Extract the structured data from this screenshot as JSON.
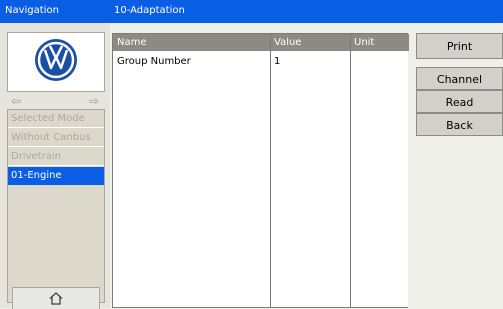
{
  "titlebar": {
    "nav_title": "Navigation",
    "page_title": "10-Adaptation"
  },
  "logo": {
    "icon": "vw-logo-icon"
  },
  "nav": {
    "back_icon": "arrow-left-icon",
    "forward_icon": "arrow-right-icon",
    "items": [
      {
        "label": "Selected Mode",
        "active": false
      },
      {
        "label": "Without Canbus",
        "active": false
      },
      {
        "label": "Drivetrain",
        "active": false
      },
      {
        "label": "01-Engine",
        "active": true
      }
    ]
  },
  "home": {
    "icon": "home-icon"
  },
  "table": {
    "headers": [
      "Name",
      "Value",
      "Unit"
    ],
    "rows": [
      [
        "Group Number",
        "1",
        ""
      ]
    ]
  },
  "buttons": {
    "print": "Print",
    "channel": "Channel",
    "read": "Read",
    "back": "Back"
  },
  "colors": {
    "accent": "#0a5ee6",
    "header": "#8c8a84",
    "panel": "#e6e4dc"
  }
}
